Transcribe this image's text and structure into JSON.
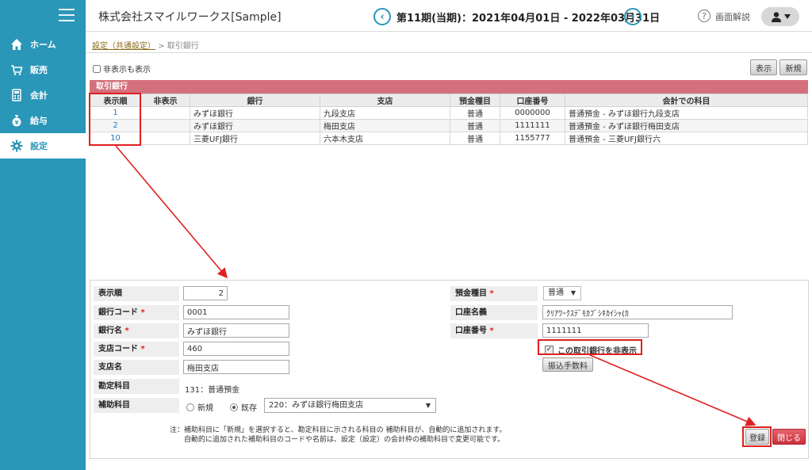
{
  "sidebar": {
    "items": [
      {
        "label": "ホーム",
        "icon": "home-icon"
      },
      {
        "label": "販売",
        "icon": "cart-icon"
      },
      {
        "label": "会計",
        "icon": "calculator-icon"
      },
      {
        "label": "給与",
        "icon": "money-bag-icon"
      },
      {
        "label": "設定",
        "icon": "gear-icon"
      }
    ],
    "active": "設定"
  },
  "header": {
    "company": "株式会社スマイルワークス[Sample]",
    "period": "第11期(当期)：2021年04月01日 - 2022年03月31日",
    "help_label": "画面解説"
  },
  "breadcrumb": {
    "parent": "設定（共通設定）",
    "separator": ">",
    "current": "取引銀行"
  },
  "toolbar": {
    "show_hidden_label": "非表示も表示",
    "show_label": "表示",
    "new_label": "新規"
  },
  "table": {
    "title": "取引銀行",
    "headers": [
      "表示順",
      "非表示",
      "銀行",
      "支店",
      "預金種目",
      "口座番号",
      "会計での科目"
    ],
    "rows": [
      {
        "order": "1",
        "hidden": "",
        "bank": "みずほ銀行",
        "branch": "九段支店",
        "type": "普通",
        "number": "0000000",
        "account": "普通預金 - みずほ銀行九段支店"
      },
      {
        "order": "2",
        "hidden": "",
        "bank": "みずほ銀行",
        "branch": "梅田支店",
        "type": "普通",
        "number": "1111111",
        "account": "普通預金 - みずほ銀行梅田支店"
      },
      {
        "order": "10",
        "hidden": "",
        "bank": "三菱UFJ銀行",
        "branch": "六本木支店",
        "type": "普通",
        "number": "1155777",
        "account": "普通預金 - 三菱UFJ銀行六"
      }
    ]
  },
  "form": {
    "order_label": "表示順",
    "order_value": "2",
    "bank_code_label": "銀行コード",
    "bank_code_value": "0001",
    "bank_name_label": "銀行名",
    "bank_name_value": "みずほ銀行",
    "branch_code_label": "支店コード",
    "branch_code_value": "460",
    "branch_name_label": "支店名",
    "branch_name_value": "梅田支店",
    "account_subject_label": "勘定科目",
    "account_subject_value": "131：普通預金",
    "sub_subject_label": "補助科目",
    "radio_new": "新規",
    "radio_existing": "既存",
    "sub_subject_value": "220：みずほ銀行梅田支店",
    "deposit_type_label": "預金種目",
    "deposit_type_value": "普通",
    "holder_label": "口座名義",
    "holder_value": "ｸﾘｱﾜｰｸｽﾃﾞﾓｶﾌﾞｼｷｶｲｼｬ(ｶ",
    "number_label": "口座番号",
    "number_value": "1111111",
    "hide_label": "この取引銀行を非表示",
    "hide_checked": true,
    "fee_button": "振込手数料",
    "required_mark": "*",
    "note_line1": "注：補助科目に「新規」を選択すると、勘定科目に示される科目の 補助科目が、自動的に追加されます。",
    "note_line2": "自動的に追加された補助科目のコードや名前は、設定（設定）の会計枠の補助科目で変更可能です。",
    "register_label": "登録",
    "close_label": "閉じる"
  },
  "colors": {
    "sidebar": "#2a96b8",
    "table_title": "#d4707c",
    "annotation": "#e02020",
    "close_button": "#d0404b"
  }
}
